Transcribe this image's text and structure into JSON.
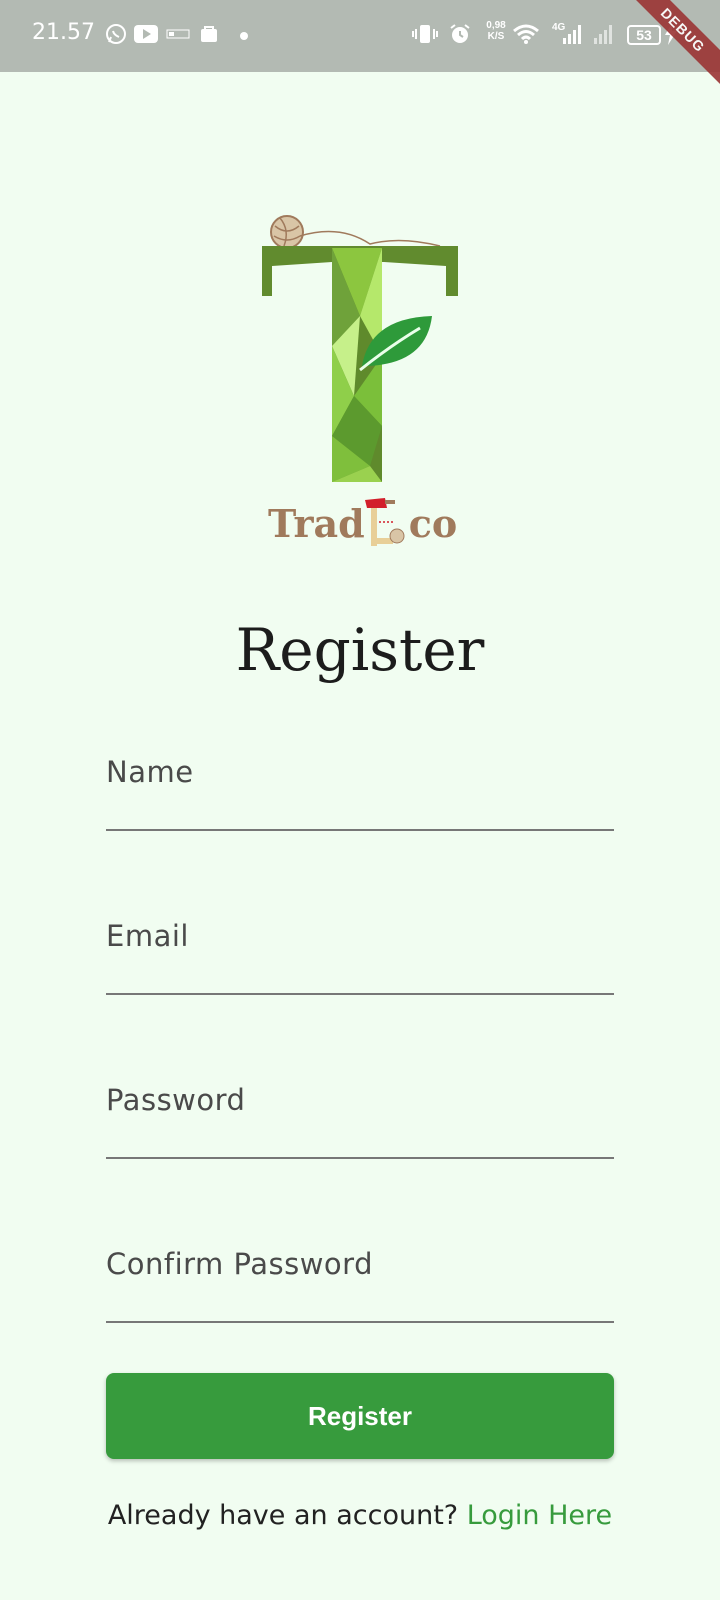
{
  "status_bar": {
    "time": "21.57",
    "net_speed_value": "0,98",
    "net_speed_unit": "K/S",
    "network_type": "4G",
    "battery": "53",
    "notification_icons": [
      "whatsapp-icon",
      "youtube-icon",
      "bni-icon",
      "app-icon"
    ]
  },
  "debug_banner": "DEBUG",
  "brand": {
    "name_part1": "Trad",
    "name_part2": "co"
  },
  "page_title": "Register",
  "form": {
    "fields": [
      {
        "label": "Name",
        "value": ""
      },
      {
        "label": "Email",
        "value": ""
      },
      {
        "label": "Password",
        "value": ""
      },
      {
        "label": "Confirm Password",
        "value": ""
      }
    ],
    "submit_label": "Register"
  },
  "footer": {
    "prompt": "Already have an account? ",
    "link": "Login Here"
  },
  "colors": {
    "background": "#f1fdf1",
    "primary": "#379b3d",
    "status_bar": "#b3bab3",
    "brand_text": "#a07a5c"
  }
}
